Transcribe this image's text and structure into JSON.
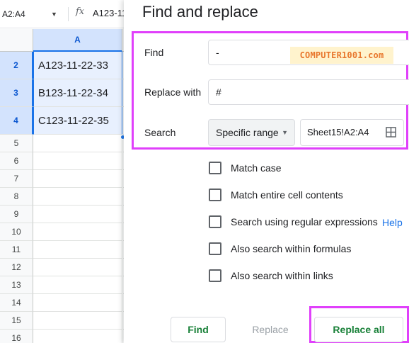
{
  "formula_bar": {
    "name_box": "A2:A4",
    "fx_symbol": "fx",
    "formula_value": "A123-11"
  },
  "grid": {
    "column_header": "A",
    "rows": [
      {
        "num": "2",
        "value": "A123-11-22-33",
        "selected": true
      },
      {
        "num": "3",
        "value": "B123-11-22-34",
        "selected": true
      },
      {
        "num": "4",
        "value": "C123-11-22-35",
        "selected": true
      },
      {
        "num": "5",
        "value": "",
        "selected": false
      },
      {
        "num": "6",
        "value": "",
        "selected": false
      },
      {
        "num": "7",
        "value": "",
        "selected": false
      },
      {
        "num": "8",
        "value": "",
        "selected": false
      },
      {
        "num": "9",
        "value": "",
        "selected": false
      },
      {
        "num": "10",
        "value": "",
        "selected": false
      },
      {
        "num": "11",
        "value": "",
        "selected": false
      },
      {
        "num": "12",
        "value": "",
        "selected": false
      },
      {
        "num": "13",
        "value": "",
        "selected": false
      },
      {
        "num": "14",
        "value": "",
        "selected": false
      },
      {
        "num": "15",
        "value": "",
        "selected": false
      },
      {
        "num": "16",
        "value": "",
        "selected": false
      }
    ]
  },
  "dialog": {
    "title": "Find and replace",
    "find_label": "Find",
    "find_value": "-",
    "replace_label": "Replace with",
    "replace_value": "#",
    "search_label": "Search",
    "search_scope": "Specific range",
    "search_range": "Sheet15!A2:A4",
    "watermark": "COMPUTER1001.com",
    "options": [
      {
        "label": "Match case",
        "checked": false
      },
      {
        "label": "Match entire cell contents",
        "checked": false
      },
      {
        "label": "Search using regular expressions",
        "checked": false
      },
      {
        "label": "Also search within formulas",
        "checked": false
      },
      {
        "label": "Also search within links",
        "checked": false
      }
    ],
    "help_link": "Help",
    "buttons": {
      "find": "Find",
      "replace": "Replace",
      "replace_all": "Replace all"
    }
  },
  "colors": {
    "highlight": "#e040fb",
    "accent_blue": "#1a73e8",
    "button_green": "#188038"
  },
  "icons": {
    "name_box_dropdown": "caret-down-icon",
    "scope_dropdown": "caret-down-icon",
    "range_picker": "grid-icon"
  }
}
